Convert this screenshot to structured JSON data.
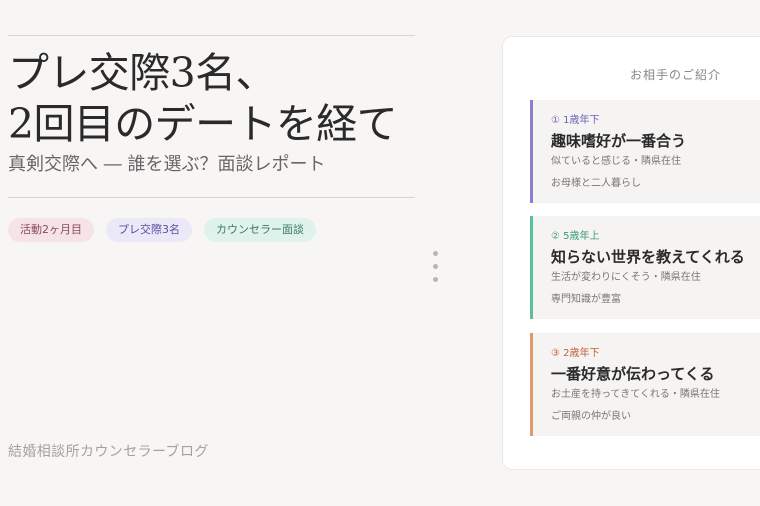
{
  "article": {
    "title_line1": "プレ交際3名、",
    "title_line2": "2回目のデートを経て",
    "subtitle": "真剣交際へ ― 誰を選ぶ？面談レポート",
    "tags": [
      "活動2ヶ月目",
      "プレ交際3名",
      "カウンセラー面談"
    ]
  },
  "footer": {
    "brand": "結婚相談所カウンセラーブログ"
  },
  "panel": {
    "title": "お相手のご紹介",
    "cards": [
      {
        "label": "① 1歳年下",
        "heading": "趣味嗜好が一番合う",
        "description": "似ていると感じる・隣県在住",
        "note": "お母様と二人暮らし",
        "accent_color": "#8a7fd0"
      },
      {
        "label": "② 5歳年上",
        "heading": "知らない世界を教えてくれる",
        "description": "生活が変わりにくそう・隣県在住",
        "note": "専門知識が豊富",
        "accent_color": "#57c29a"
      },
      {
        "label": "③ 2歳年下",
        "heading": "一番好意が伝わってくる",
        "description": "お土産を持ってきてくれる・隣県在住",
        "note": "ご両親の仲が良い",
        "accent_color": "#e09a72"
      }
    ]
  }
}
